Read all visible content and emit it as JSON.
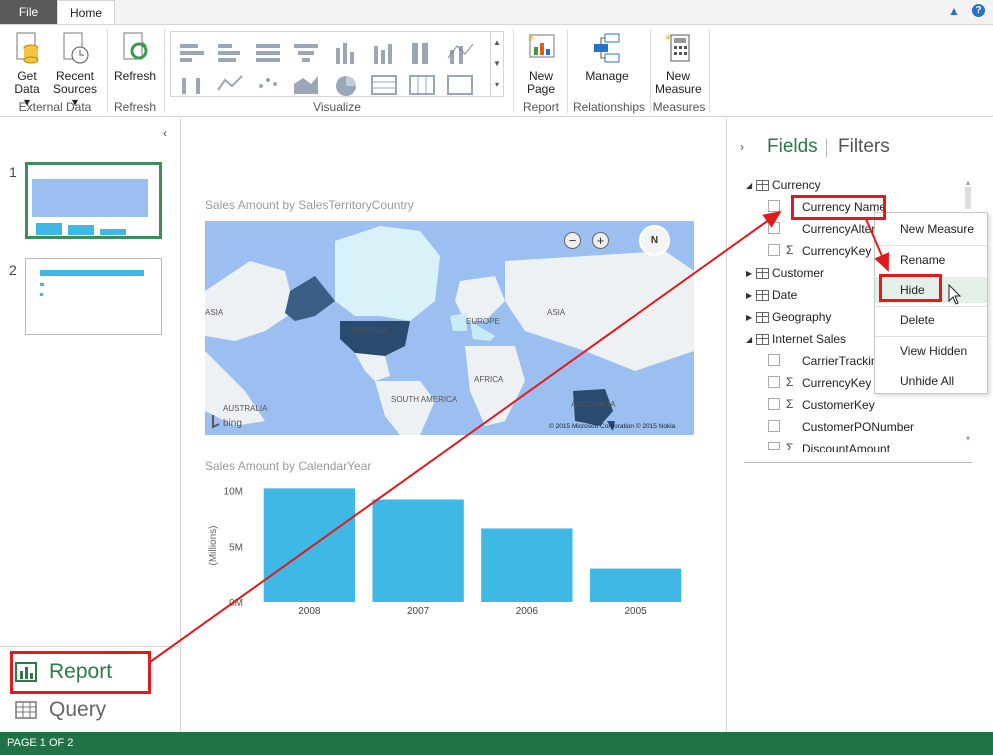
{
  "ribbon": {
    "tabs": {
      "file": "File",
      "home": "Home"
    },
    "buttons": {
      "get_data": [
        "Get",
        "Data ▾"
      ],
      "recent_sources": [
        "Recent",
        "Sources ▾"
      ],
      "refresh": "Refresh",
      "new_page": [
        "New",
        "Page"
      ],
      "manage": "Manage",
      "new_measure": [
        "New",
        "Measure"
      ]
    },
    "groups": {
      "external_data": "External Data",
      "refresh": "Refresh",
      "visualize": "Visualize",
      "report": "Report",
      "relationships": "Relationships",
      "measures": "Measures"
    }
  },
  "pages": {
    "thumb_1_num": "1",
    "thumb_2_num": "2"
  },
  "nav": {
    "report": "Report",
    "query": "Query"
  },
  "canvas": {
    "map_title": "Sales Amount by SalesTerritoryCountry",
    "map_labels": {
      "asia_left": "ASIA",
      "america": "AMERICA",
      "europe": "EUROPE",
      "asia_right": "ASIA",
      "africa": "AFRICA",
      "south_america": "SOUTH AMERICA",
      "australia_left": "AUSTRALIA",
      "australia_right": "AUSTRALIA"
    },
    "map_copyright": "© 2015 Microsoft Corporation    © 2015 Nokia",
    "bing": "bing",
    "chart_title": "Sales Amount by CalendarYear"
  },
  "chart_data": {
    "type": "bar",
    "title": "Sales Amount by CalendarYear",
    "categories": [
      "2008",
      "2007",
      "2006",
      "2005"
    ],
    "values": [
      10.2,
      9.2,
      6.6,
      3.0
    ],
    "ylabel": "(Millions)",
    "yticks": [
      "0M",
      "5M",
      "10M"
    ],
    "ylim": [
      0,
      10.5
    ],
    "color": "#3fb8e5"
  },
  "fields_pane": {
    "fields_tab": "Fields",
    "filters_tab": "Filters",
    "tables": {
      "currency": "Currency",
      "customer": "Customer",
      "date": "Date",
      "geography": "Geography",
      "internet_sales": "Internet Sales"
    },
    "currency_fields": [
      "Currency Name",
      "CurrencyAlter",
      "CurrencyKey"
    ],
    "internet_sales_fields": [
      "CarrierTrackin",
      "CurrencyKey",
      "CustomerKey",
      "CustomerPONumber",
      "DiscountAmount"
    ]
  },
  "context_menu": {
    "new_measure": "New Measure",
    "rename": "Rename",
    "hide": "Hide",
    "delete": "Delete",
    "view_hidden": "View Hidden",
    "unhide_all": "Unhide All"
  },
  "status_bar": {
    "page": "PAGE 1 OF 2"
  },
  "colors": {
    "accent_green": "#217346",
    "annotation_red": "#e01b1b",
    "bar_blue": "#3fb8e5"
  }
}
